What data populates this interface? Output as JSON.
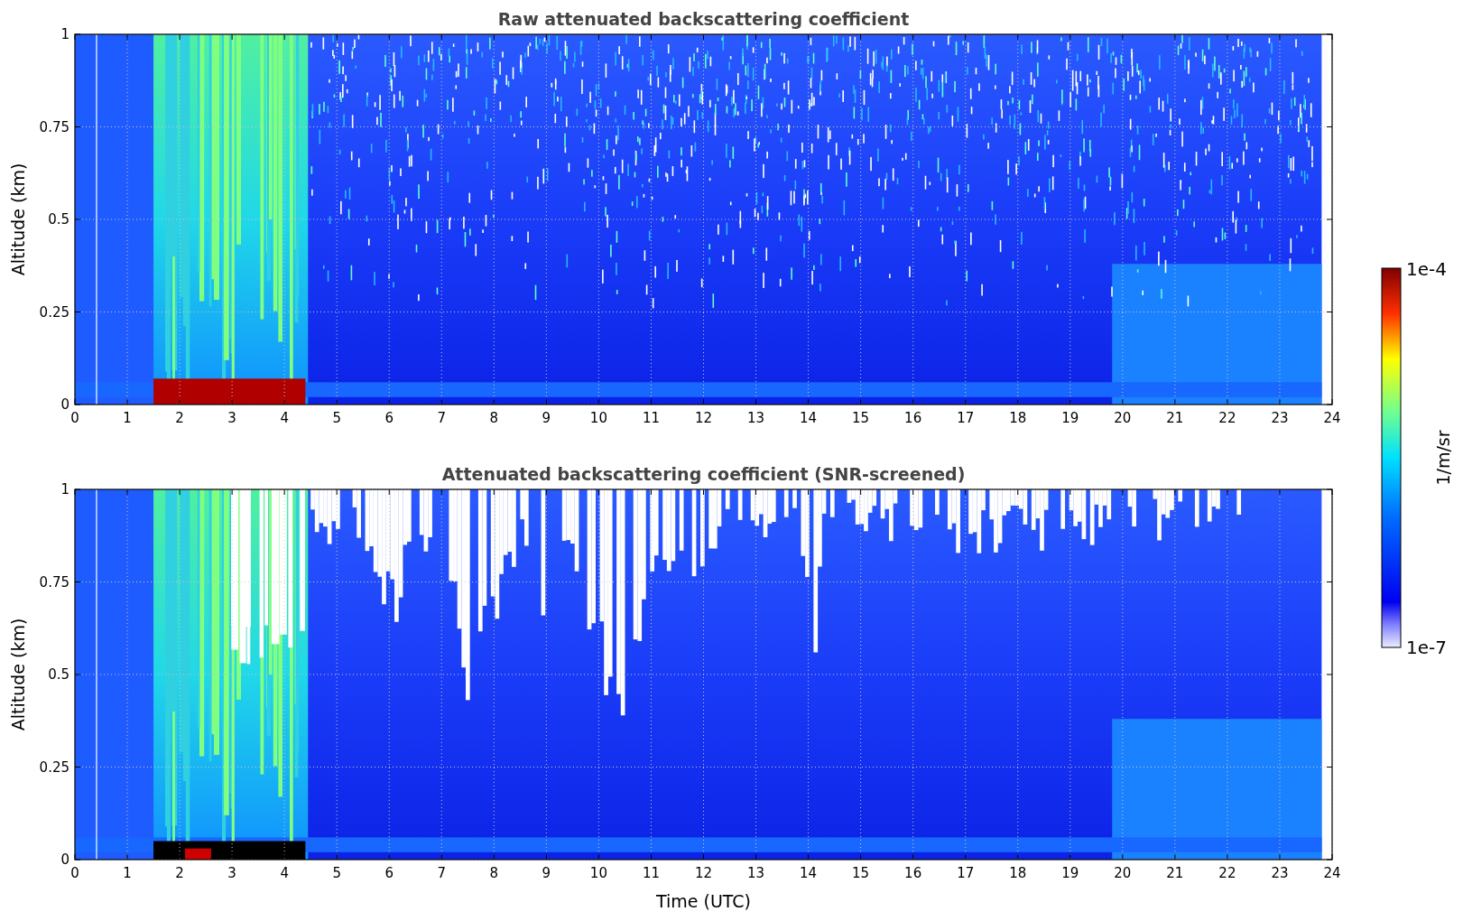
{
  "panels": [
    {
      "kind": "raw",
      "title": "Raw attenuated backscattering coefficient",
      "ylabel": "Altitude (km)",
      "yticks": [
        "1",
        "0.75",
        "0.5",
        "0.25",
        "0"
      ],
      "xticks": [
        "0",
        "1",
        "2",
        "3",
        "4",
        "5",
        "6",
        "7",
        "8",
        "9",
        "10",
        "11",
        "12",
        "13",
        "14",
        "15",
        "16",
        "17",
        "18",
        "19",
        "20",
        "21",
        "22",
        "23",
        "24"
      ]
    },
    {
      "kind": "screened",
      "title": "Attenuated backscattering coefficient (SNR-screened)",
      "ylabel": "Altitude (km)",
      "yticks": [
        "1",
        "0.75",
        "0.5",
        "0.25",
        "0"
      ],
      "xticks": [
        "0",
        "1",
        "2",
        "3",
        "4",
        "5",
        "6",
        "7",
        "8",
        "9",
        "10",
        "11",
        "12",
        "13",
        "14",
        "15",
        "16",
        "17",
        "18",
        "19",
        "20",
        "21",
        "22",
        "23",
        "24"
      ]
    }
  ],
  "xlabel": "Time (UTC)",
  "colorbar": {
    "max_label": "1e-4",
    "min_label": "1e-7",
    "label": "1/m/sr"
  }
}
